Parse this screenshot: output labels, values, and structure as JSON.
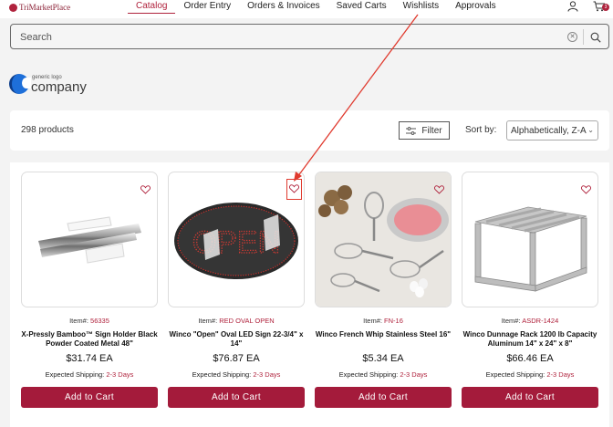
{
  "brand": {
    "name": "TriMarketPlace"
  },
  "nav": {
    "items": [
      {
        "label": "Catalog",
        "active": true
      },
      {
        "label": "Order Entry",
        "active": false
      },
      {
        "label": "Orders & Invoices",
        "active": false
      },
      {
        "label": "Saved Carts",
        "active": false
      },
      {
        "label": "Wishlists",
        "active": false
      },
      {
        "label": "Approvals",
        "active": false
      }
    ],
    "cart_count": "3",
    "icons": [
      "user-icon",
      "cart-icon"
    ]
  },
  "search": {
    "placeholder": "Search",
    "value": ""
  },
  "company_logo": {
    "small_text": "generic logo",
    "big_text": "company"
  },
  "toolbar": {
    "count": "298 products",
    "filter_label": "Filter",
    "sort_label": "Sort by:",
    "sort_value": "Alphabetically, Z-A"
  },
  "products": [
    {
      "item_label": "Item#:",
      "item_code": "56335",
      "name": "X-Pressly Bamboo™ Sign Holder Black Powder Coated Metal 48\"",
      "price": "$31.74 EA",
      "ship_label": "Expected Shipping:",
      "ship_days": "2-3 Days",
      "button": "Add to Cart",
      "image": "sign-holder-rod"
    },
    {
      "item_label": "Item#:",
      "item_code": "RED OVAL OPEN",
      "name": "Winco \"Open\" Oval LED Sign 22-3/4\" x 14\"",
      "price": "$76.87 EA",
      "ship_label": "Expected Shipping:",
      "ship_days": "2-3 Days",
      "button": "Add to Cart",
      "image": "open-led-sign"
    },
    {
      "item_label": "Item#:",
      "item_code": "FN-16",
      "name": "Winco French Whip Stainless Steel 16\"",
      "price": "$5.34 EA",
      "ship_label": "Expected Shipping:",
      "ship_days": "2-3 Days",
      "button": "Add to Cart",
      "image": "whisks-and-bowl"
    },
    {
      "item_label": "Item#:",
      "item_code": "ASDR-1424",
      "name": "Winco Dunnage Rack 1200 lb Capacity Aluminum 14\" x 24\" x 8\"",
      "price": "$66.46 EA",
      "ship_label": "Expected Shipping:",
      "ship_days": "2-3 Days",
      "button": "Add to Cart",
      "image": "dunnage-rack"
    }
  ],
  "colors": {
    "accent": "#a41b3b",
    "annotation": "#e03a2e"
  }
}
